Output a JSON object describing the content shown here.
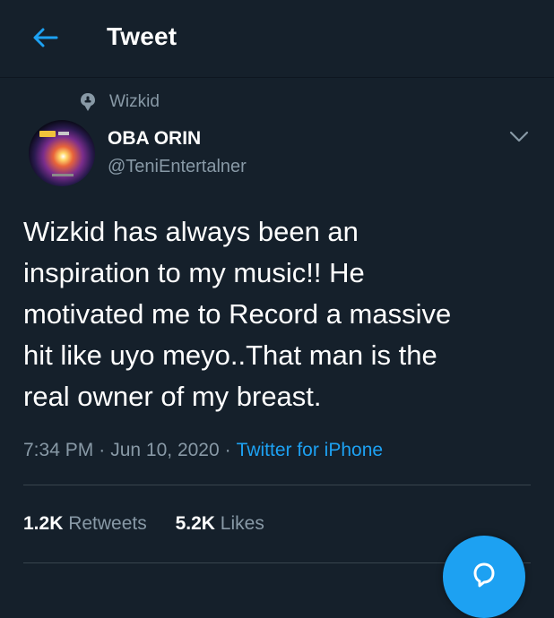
{
  "header": {
    "title": "Tweet",
    "back_icon": "arrow-left-icon"
  },
  "context": {
    "icon": "pin-icon",
    "label": "Wizkid"
  },
  "author": {
    "name": "OBA ORIN",
    "handle": "@TeniEntertalner"
  },
  "tweet": {
    "lines": [
      "Wizkid has always been an",
      "inspiration to my music!! He",
      "motivated me to Record a massive",
      "hit like uyo meyo..That man is the",
      "real owner of my breast."
    ]
  },
  "meta": {
    "time": "7:34 PM",
    "sep1": "·",
    "date": "Jun 10, 2020",
    "sep2": "·",
    "source": "Twitter for iPhone"
  },
  "stats": {
    "retweets": {
      "count": "1.2K",
      "label": "Retweets"
    },
    "likes": {
      "count": "5.2K",
      "label": "Likes"
    }
  },
  "colors": {
    "background": "#15202b",
    "accent": "#1da1f2",
    "secondary_text": "#8899a6",
    "divider": "#38444d"
  }
}
